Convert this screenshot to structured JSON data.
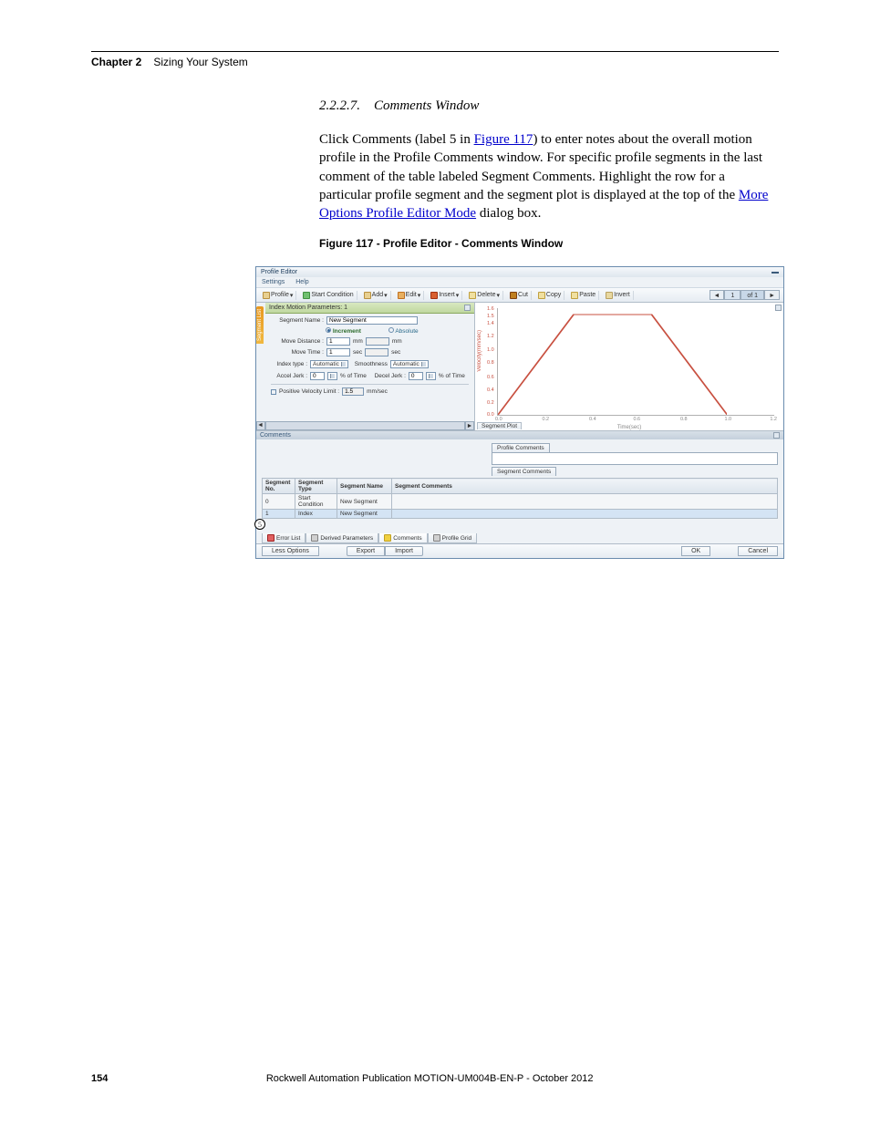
{
  "header": {
    "chapter_label": "Chapter 2",
    "chapter_title": "Sizing Your System"
  },
  "section": {
    "number": "2.2.2.7.",
    "title": "Comments Window"
  },
  "body": {
    "p1_before_link": "Click Comments (label 5 in ",
    "p1_link": "Figure 117",
    "p1_after_link": ") to enter notes about the overall motion profile in the Profile Comments window. For specific profile segments in the last comment of the table labeled Segment Comments. Highlight the row for a particular profile segment and the segment plot is displayed at the top of the ",
    "p1_link2": "More Options Profile Editor Mode",
    "p1_tail": " dialog box."
  },
  "figure": {
    "caption": "Figure 117 - Profile Editor - Comments Window"
  },
  "editor": {
    "title": "Profile Editor",
    "menu": {
      "settings": "Settings",
      "help": "Help"
    },
    "toolbar": {
      "profile": "Profile",
      "start_condition": "Start Condition",
      "add": "Add",
      "edit": "Edit",
      "insert": "Insert",
      "delete": "Delete",
      "cut": "Cut",
      "copy": "Copy",
      "paste": "Paste",
      "invert": "Invert"
    },
    "pager": {
      "prev": "◄",
      "current": "1",
      "of_label": "of 1",
      "next": "►"
    },
    "segment_list_tab": "Segment List",
    "imp_header": "Index Motion Parameters: 1",
    "form": {
      "segment_name_label": "Segment Name :",
      "segment_name_value": "New Segment",
      "increment": "Increment",
      "absolute": "Absolute",
      "move_distance_label": "Move Distance :",
      "move_distance_value": "1",
      "mm": "mm",
      "move_time_label": "Move Time :",
      "move_time_value": "1",
      "sec": "sec",
      "index_type_label": "Index type :",
      "index_type_value": "Automatic",
      "smoothness_label": "Smoothness",
      "smoothness_value": "Automatic",
      "accel_jerk_label": "Accel Jerk :",
      "accel_jerk_value": "0",
      "pct_of_time": "% of Time",
      "decel_jerk_label": "Decel Jerk :",
      "decel_jerk_value": "0",
      "pos_vel_limit_label": "Positive Velocity Limit :",
      "pos_vel_limit_value": "1.5",
      "mm_sec": "mm/sec"
    },
    "chart": {
      "ylabel": "Velocity(mm/sec)",
      "xlabel": "Time(sec)",
      "yticks": [
        "1.6",
        "1.5",
        "1.4",
        "1.2",
        "1.0",
        "0.8",
        "0.6",
        "0.4",
        "0.2",
        "0.0"
      ],
      "xticks": [
        "0.0",
        "0.2",
        "0.4",
        "0.6",
        "0.8",
        "1.0",
        "1.2"
      ]
    },
    "segment_plot_tab": "Segment Plot",
    "comments": {
      "header": "Comments",
      "profile_comments_label": "Profile Comments",
      "segment_comments_label": "Segment Comments",
      "table": {
        "h1": "Segment No.",
        "h2": "Segment Type",
        "h3": "Segment Name",
        "h4": "Segment Comments",
        "rows": [
          {
            "no": "0",
            "type": "Start Condition",
            "name": "New Segment",
            "comments": ""
          },
          {
            "no": "1",
            "type": "Index",
            "name": "New Segment",
            "comments": ""
          }
        ]
      }
    },
    "bottom_tabs": {
      "error_list": "Error List",
      "derived_parameters": "Derived Parameters",
      "comments": "Comments",
      "profile_grid": "Profile Grid"
    },
    "footer": {
      "less_options": "Less Options",
      "export": "Export",
      "import": "Import",
      "ok": "OK",
      "cancel": "Cancel"
    },
    "callout_5": "5"
  },
  "chart_data": {
    "type": "line",
    "title": "",
    "xlabel": "Time(sec)",
    "ylabel": "Velocity(mm/sec)",
    "xlim": [
      0.0,
      1.2
    ],
    "ylim": [
      0.0,
      1.6
    ],
    "series": [
      {
        "name": "Velocity",
        "x": [
          0.0,
          0.33,
          0.67,
          1.0
        ],
        "y": [
          0.0,
          1.5,
          1.5,
          0.0
        ],
        "color": "#c85040"
      }
    ]
  },
  "footer": {
    "page_num": "154",
    "publication": "Rockwell Automation Publication MOTION-UM004B-EN-P - October 2012"
  }
}
